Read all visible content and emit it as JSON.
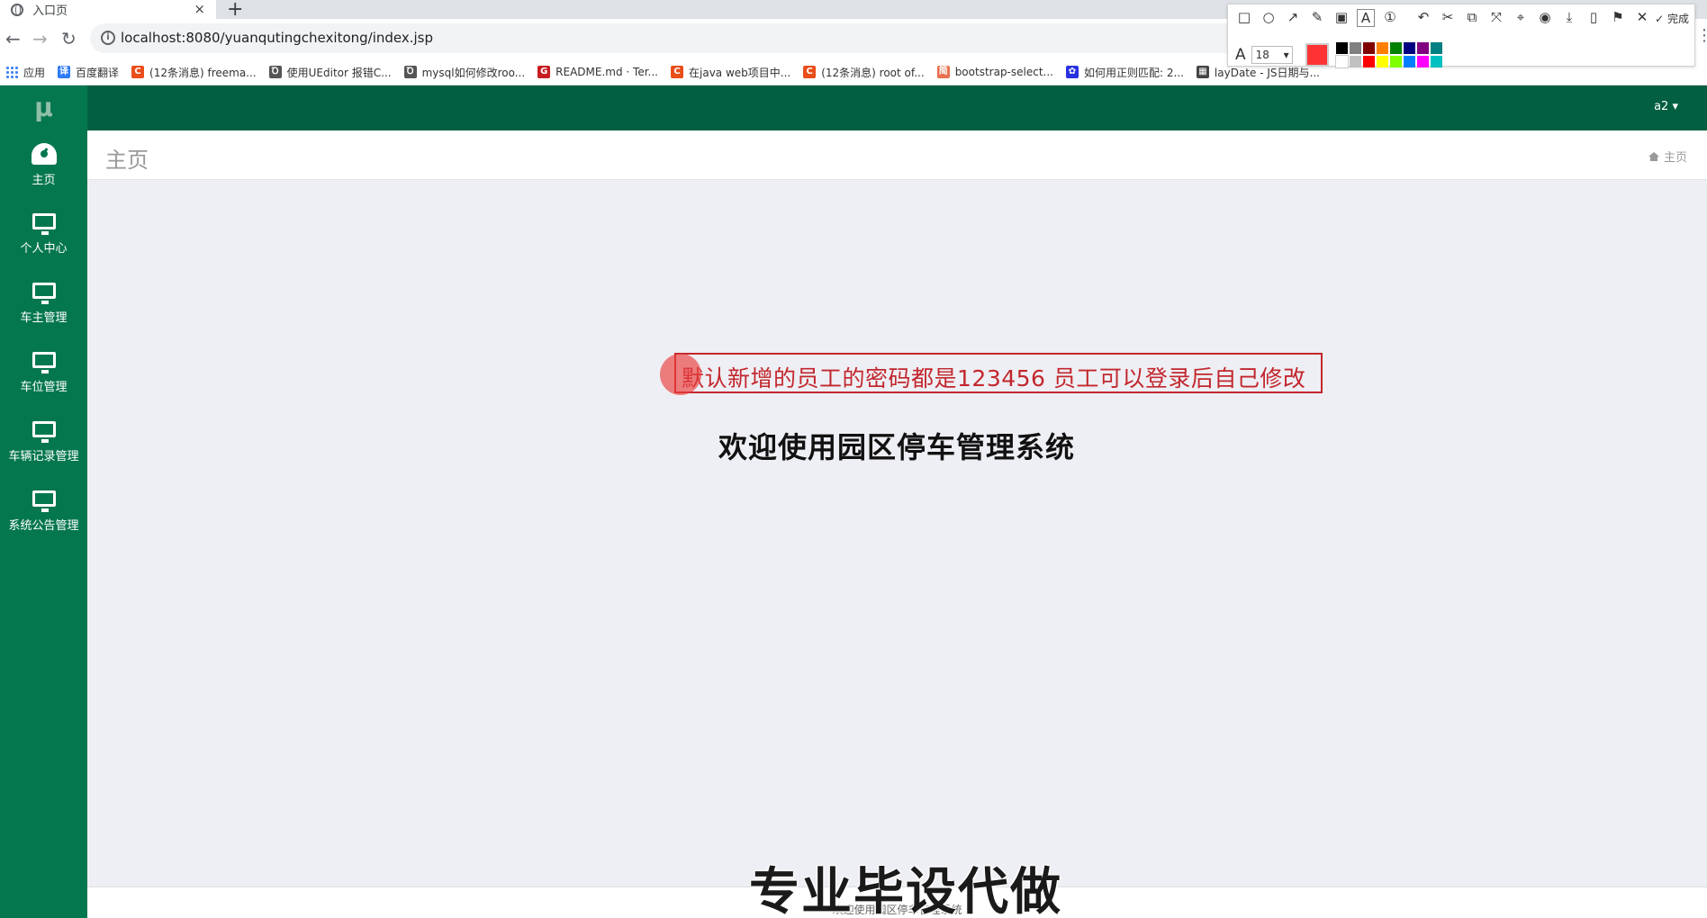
{
  "browser": {
    "tab_title": "入口页",
    "tab_close": "×",
    "new_tab": "+",
    "back": "←",
    "forward": "→",
    "reload": "↻",
    "url": "localhost:8080/yuanqutingchexitong/index.jsp",
    "star": "☆",
    "menu": "⋮"
  },
  "bookmarks": [
    {
      "label": "应用",
      "icon": "apps-grid-icon"
    },
    {
      "label": "百度翻译",
      "icon": "baidu-translate-icon",
      "color": "#2e7bf6",
      "glyph": "译"
    },
    {
      "label": "(12条消息) freema...",
      "icon": "csdn-icon",
      "color": "#e94e1b",
      "glyph": "C"
    },
    {
      "label": "使用UEditor 报错C...",
      "icon": "page-icon",
      "color": "#555555",
      "glyph": "Ꝺ"
    },
    {
      "label": "mysql如何修改roo...",
      "icon": "page-icon",
      "color": "#555555",
      "glyph": "Ꝺ"
    },
    {
      "label": "README.md · Ter...",
      "icon": "gitee-icon",
      "color": "#c71d23",
      "glyph": "G"
    },
    {
      "label": "在java web项目中...",
      "icon": "csdn-icon",
      "color": "#e94e1b",
      "glyph": "C"
    },
    {
      "label": "(12条消息) root of...",
      "icon": "csdn-icon",
      "color": "#e94e1b",
      "glyph": "C"
    },
    {
      "label": "bootstrap-select...",
      "icon": "jianshu-icon",
      "color": "#e9704f",
      "glyph": "简"
    },
    {
      "label": "如何用正则匹配: 2...",
      "icon": "baidu-paw-icon",
      "color": "#2932e1",
      "glyph": "✿"
    },
    {
      "label": "layDate - JS日期与...",
      "icon": "calendar-icon",
      "color": "#444444",
      "glyph": "▦"
    }
  ],
  "annotation_toolbar": {
    "tools": [
      "□",
      "○",
      "↗",
      "✎",
      "▣",
      "A",
      "①",
      "↶",
      "✂",
      "⧉",
      "⤧",
      "⌖",
      "◉",
      "⤓",
      "▯",
      "⚑",
      "✕"
    ],
    "tool_names": [
      "rectangle-tool-icon",
      "ellipse-tool-icon",
      "arrow-tool-icon",
      "pen-tool-icon",
      "mosaic-tool-icon",
      "text-tool-icon",
      "number-tool-icon",
      "undo-icon",
      "cut-icon",
      "copy-icon",
      "pin-icon",
      "target-icon",
      "record-icon",
      "download-icon",
      "phone-icon",
      "bookmark-icon",
      "close-icon"
    ],
    "done_label": "✓ 完成",
    "font_label": "A",
    "font_size": "18",
    "current_color": "#ff3333",
    "palette": [
      "#000000",
      "#808080",
      "#800000",
      "#ff8000",
      "#008000",
      "#000080",
      "#800080",
      "#008080",
      "#ffffff",
      "#c0c0c0",
      "#ff0000",
      "#ffff00",
      "#80ff00",
      "#0080ff",
      "#ff00ff",
      "#00c0c0"
    ]
  },
  "app": {
    "logo": "μ",
    "user": "a2 ▾",
    "colors": {
      "topbar": "#035f41",
      "sidebar": "#05774f",
      "content_bg": "#eeeff4",
      "note": "#c2272d"
    }
  },
  "sidebar": {
    "items": [
      {
        "label": "主页",
        "icon": "dashboard-icon"
      },
      {
        "label": "个人中心",
        "icon": "desktop-icon"
      },
      {
        "label": "车主管理",
        "icon": "desktop-icon"
      },
      {
        "label": "车位管理",
        "icon": "desktop-icon"
      },
      {
        "label": "车辆记录管理",
        "icon": "desktop-icon"
      },
      {
        "label": "系统公告管理",
        "icon": "desktop-icon"
      }
    ]
  },
  "header": {
    "title": "主页",
    "breadcrumb": "主页"
  },
  "main": {
    "note": "默认新增的员工的密码都是123456   员工可以登录后自己修改",
    "welcome": "欢迎使用园区停车管理系统",
    "watermark": "专业毕设代做",
    "footer": "欢迎使用园区停车管理系统"
  }
}
